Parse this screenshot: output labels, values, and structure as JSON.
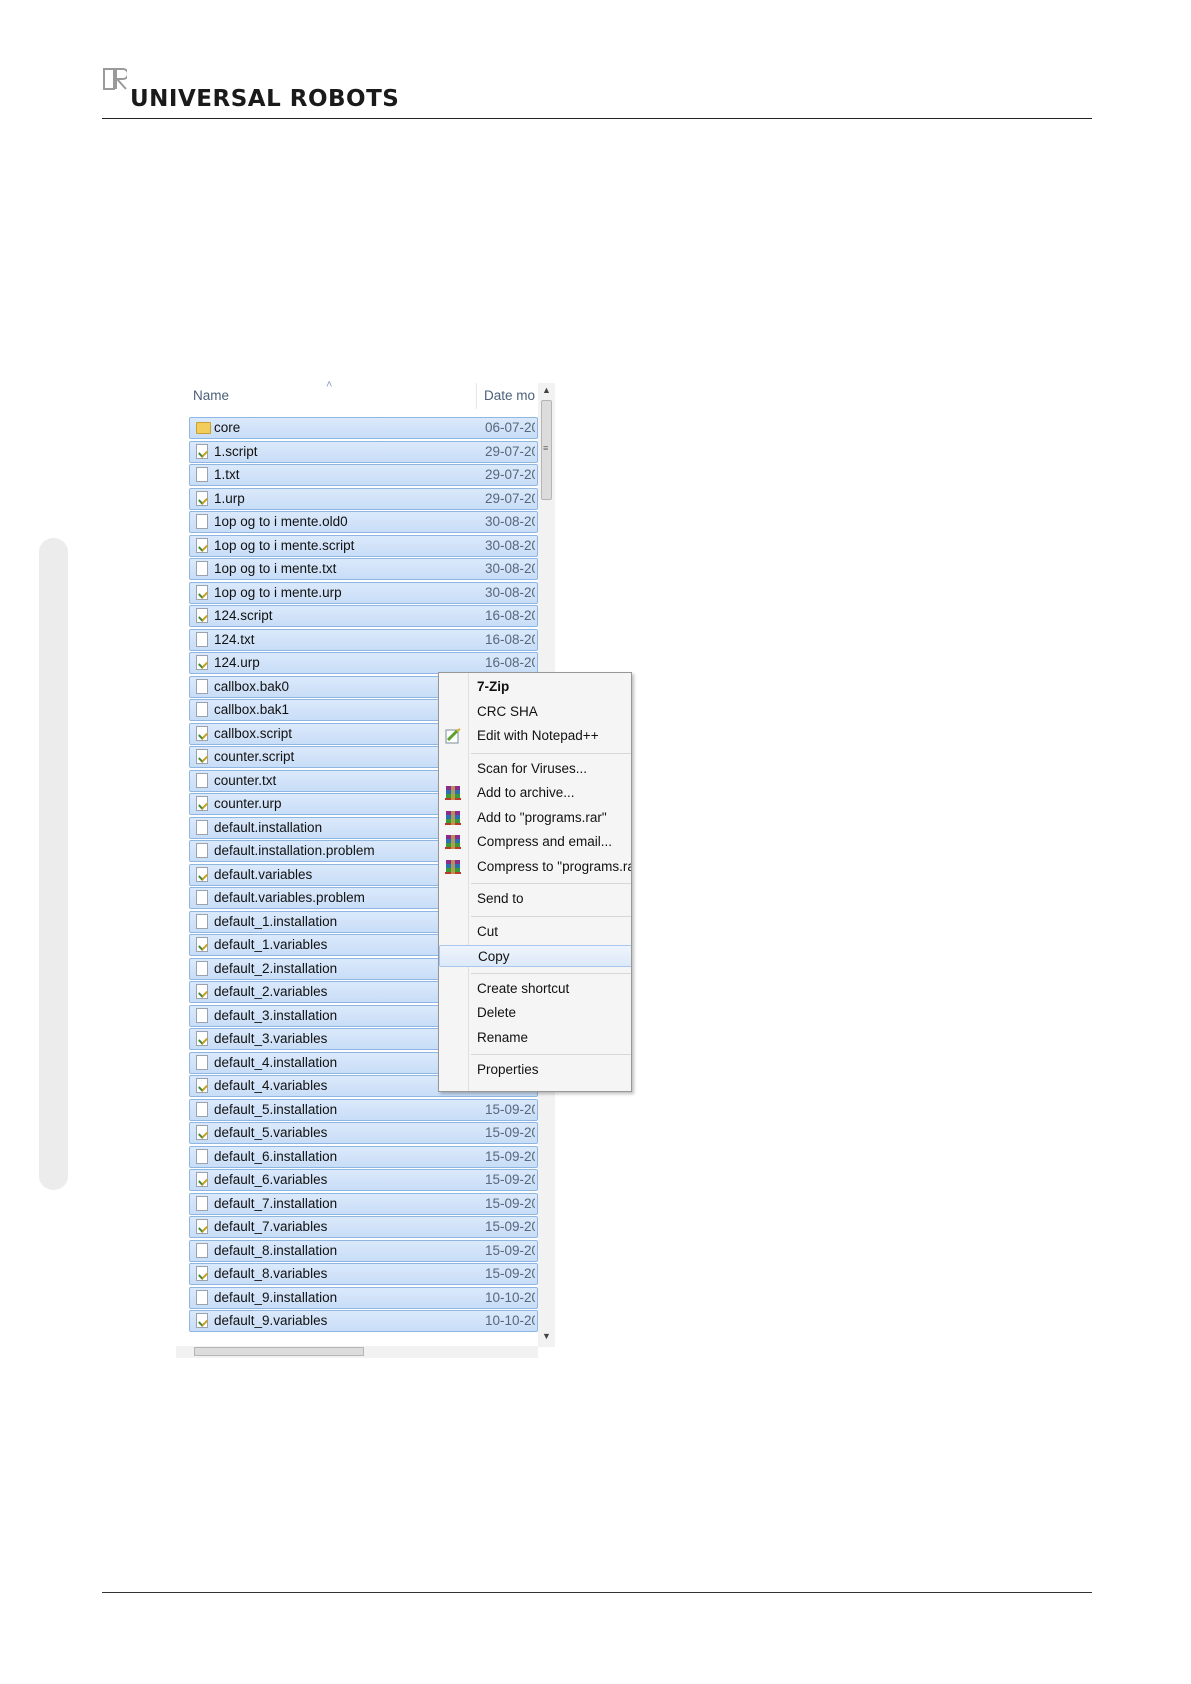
{
  "header": {
    "logo_text": "UNIVERSAL ROBOTS"
  },
  "explorer": {
    "columns": {
      "name": "Name",
      "date": "Date mo"
    },
    "files": [
      {
        "name": "core",
        "date": "06-07-20",
        "icon": "folder-icon"
      },
      {
        "name": "1.script",
        "date": "29-07-20",
        "icon": "script-file-icon"
      },
      {
        "name": "1.txt",
        "date": "29-07-20",
        "icon": "text-file-icon"
      },
      {
        "name": "1.urp",
        "date": "29-07-20",
        "icon": "script-file-icon"
      },
      {
        "name": "1op og to i mente.old0",
        "date": "30-08-20",
        "icon": "text-file-icon"
      },
      {
        "name": "1op og to i mente.script",
        "date": "30-08-20",
        "icon": "script-file-icon"
      },
      {
        "name": "1op og to i mente.txt",
        "date": "30-08-20",
        "icon": "text-file-icon"
      },
      {
        "name": "1op og to i mente.urp",
        "date": "30-08-20",
        "icon": "script-file-icon"
      },
      {
        "name": "124.script",
        "date": "16-08-20",
        "icon": "script-file-icon"
      },
      {
        "name": "124.txt",
        "date": "16-08-20",
        "icon": "text-file-icon"
      },
      {
        "name": "124.urp",
        "date": "16-08-20",
        "icon": "script-file-icon"
      },
      {
        "name": "callbox.bak0",
        "date": "",
        "icon": "text-file-icon"
      },
      {
        "name": "callbox.bak1",
        "date": "",
        "icon": "text-file-icon"
      },
      {
        "name": "callbox.script",
        "date": "",
        "icon": "script-file-icon"
      },
      {
        "name": "counter.script",
        "date": "",
        "icon": "script-file-icon"
      },
      {
        "name": "counter.txt",
        "date": "",
        "icon": "text-file-icon"
      },
      {
        "name": "counter.urp",
        "date": "",
        "icon": "script-file-icon"
      },
      {
        "name": "default.installation",
        "date": "",
        "icon": "text-file-icon"
      },
      {
        "name": "default.installation.problem",
        "date": "",
        "icon": "text-file-icon"
      },
      {
        "name": "default.variables",
        "date": "",
        "icon": "script-file-icon"
      },
      {
        "name": "default.variables.problem",
        "date": "",
        "icon": "text-file-icon"
      },
      {
        "name": "default_1.installation",
        "date": "",
        "icon": "text-file-icon"
      },
      {
        "name": "default_1.variables",
        "date": "",
        "icon": "script-file-icon"
      },
      {
        "name": "default_2.installation",
        "date": "",
        "icon": "text-file-icon"
      },
      {
        "name": "default_2.variables",
        "date": "",
        "icon": "script-file-icon"
      },
      {
        "name": "default_3.installation",
        "date": "",
        "icon": "text-file-icon"
      },
      {
        "name": "default_3.variables",
        "date": "",
        "icon": "script-file-icon"
      },
      {
        "name": "default_4.installation",
        "date": "",
        "icon": "text-file-icon"
      },
      {
        "name": "default_4.variables",
        "date": "",
        "icon": "script-file-icon"
      },
      {
        "name": "default_5.installation",
        "date": "15-09-20",
        "icon": "text-file-icon"
      },
      {
        "name": "default_5.variables",
        "date": "15-09-20",
        "icon": "script-file-icon"
      },
      {
        "name": "default_6.installation",
        "date": "15-09-20",
        "icon": "text-file-icon"
      },
      {
        "name": "default_6.variables",
        "date": "15-09-20",
        "icon": "script-file-icon"
      },
      {
        "name": "default_7.installation",
        "date": "15-09-20",
        "icon": "text-file-icon"
      },
      {
        "name": "default_7.variables",
        "date": "15-09-20",
        "icon": "script-file-icon"
      },
      {
        "name": "default_8.installation",
        "date": "15-09-20",
        "icon": "text-file-icon"
      },
      {
        "name": "default_8.variables",
        "date": "15-09-20",
        "icon": "script-file-icon"
      },
      {
        "name": "default_9.installation",
        "date": "10-10-20",
        "icon": "text-file-icon"
      },
      {
        "name": "default_9.variables",
        "date": "10-10-20",
        "icon": "script-file-icon"
      }
    ]
  },
  "context_menu": {
    "items": [
      {
        "label": "7-Zip",
        "bold": true,
        "icon": ""
      },
      {
        "label": "CRC SHA",
        "icon": ""
      },
      {
        "label": "Edit with Notepad++",
        "icon": "notepad-plus-plus-icon"
      },
      {
        "separator": true
      },
      {
        "label": "Scan for Viruses...",
        "icon": ""
      },
      {
        "label": "Add to archive...",
        "icon": "winrar-icon"
      },
      {
        "label": "Add to \"programs.rar\"",
        "icon": "winrar-icon"
      },
      {
        "label": "Compress and email...",
        "icon": "winrar-icon"
      },
      {
        "label": "Compress to \"programs.ra",
        "icon": "winrar-icon"
      },
      {
        "separator": true
      },
      {
        "label": "Send to",
        "icon": ""
      },
      {
        "separator": true
      },
      {
        "label": "Cut",
        "icon": ""
      },
      {
        "label": "Copy",
        "icon": "",
        "highlighted": true
      },
      {
        "separator": true
      },
      {
        "label": "Create shortcut",
        "icon": ""
      },
      {
        "label": "Delete",
        "icon": ""
      },
      {
        "label": "Rename",
        "icon": ""
      },
      {
        "separator": true
      },
      {
        "label": "Properties",
        "icon": ""
      }
    ]
  },
  "colors": {
    "selection": "#cfe2f9",
    "selection_border": "#8fb6e3",
    "menu_bg": "#f5f5f5"
  }
}
